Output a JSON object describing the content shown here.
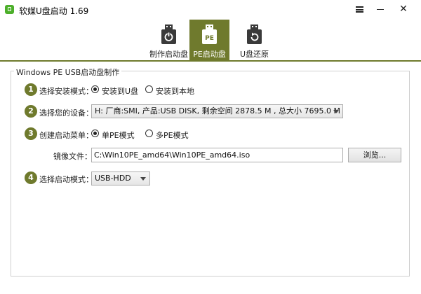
{
  "window": {
    "title": "软媒U盘启动 1.69",
    "close_glyph": "✕"
  },
  "tabs": [
    {
      "label": "制作启动盘",
      "icon": "usb-power-icon"
    },
    {
      "label": "PE启动盘",
      "icon": "usb-pe-icon",
      "badge": "PE",
      "active": true
    },
    {
      "label": "U盘还原",
      "icon": "usb-restore-icon"
    }
  ],
  "group": {
    "title": "Windows PE USB启动盘制作"
  },
  "steps": {
    "step1": {
      "number": "1",
      "label": "选择安装模式：",
      "options": [
        "安装到U盘",
        "安装到本地"
      ],
      "selected": 0
    },
    "step2": {
      "number": "2",
      "label": "选择您的设备：",
      "device": "H: 厂商:SMI, 产品:USB DISK,  剩余空间 2878.5 M , 总大小 7695.0 M"
    },
    "step3": {
      "number": "3",
      "label": "创建启动菜单：",
      "options": [
        "单PE模式",
        "多PE模式"
      ],
      "selected": 0,
      "image_label": "镜像文件：",
      "image_path": "C:\\Win10PE_amd64\\Win10PE_amd64.iso",
      "browse_label": "浏览..."
    },
    "step4": {
      "number": "4",
      "label": "选择启动模式：",
      "mode": "USB-HDD"
    }
  },
  "colors": {
    "accent": "#6f7a2d",
    "brand_icon": "#4caf2a"
  }
}
